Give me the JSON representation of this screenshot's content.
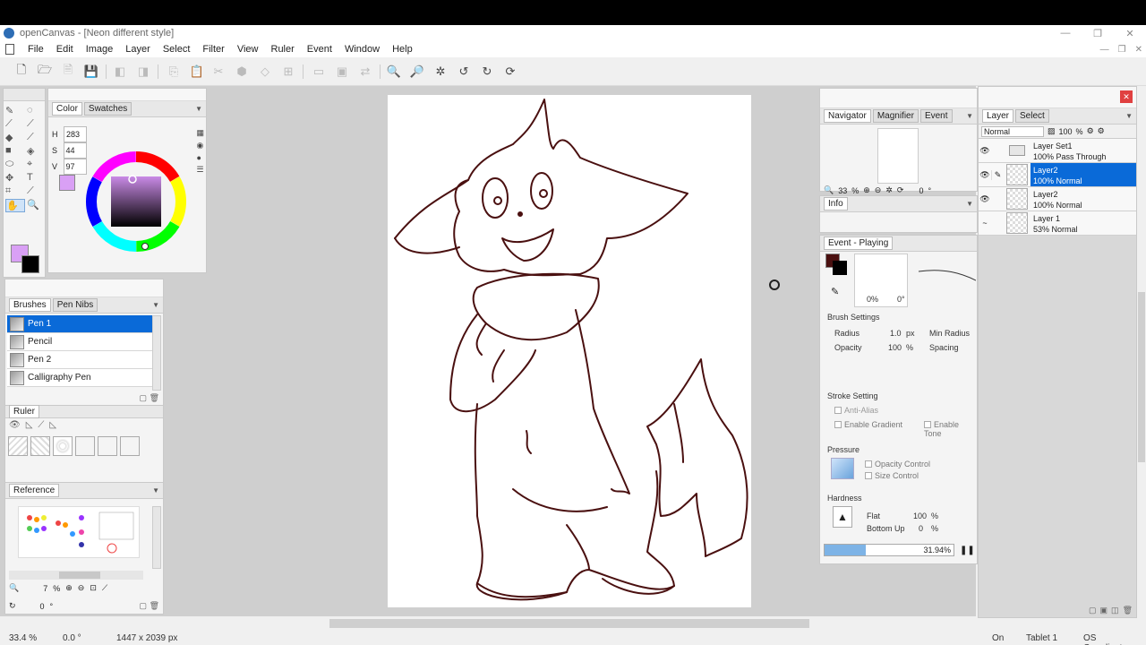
{
  "window": {
    "title": "openCanvas - [Neon different style]"
  },
  "menu": [
    "File",
    "Edit",
    "Image",
    "Layer",
    "Select",
    "Filter",
    "View",
    "Ruler",
    "Event",
    "Window",
    "Help"
  ],
  "color_panel": {
    "tabs": [
      "Color",
      "Swatches"
    ],
    "h_label": "H",
    "h": "283",
    "s_label": "S",
    "s": "44",
    "v_label": "V",
    "v": "97",
    "fg_color": "#d9a0f5",
    "bg_color": "#000000"
  },
  "brushes_panel": {
    "tabs": [
      "Brushes",
      "Pen Nibs"
    ],
    "items": [
      "Pen 1",
      "Pencil",
      "Pen 2",
      "Calligraphy Pen"
    ],
    "selected": "Pen 1"
  },
  "ruler_panel": {
    "title": "Ruler"
  },
  "reference_panel": {
    "title": "Reference",
    "zoom": "7",
    "zoom_unit": "%",
    "rotation": "0",
    "rotation_unit": "°"
  },
  "navigator_panel": {
    "tabs": [
      "Navigator",
      "Magnifier",
      "Event"
    ],
    "zoom": "33",
    "zoom_unit": "%",
    "rotation": "0",
    "rotation_unit": "°"
  },
  "info_panel": {
    "title": "Info"
  },
  "event_panel": {
    "title": "Event - Playing",
    "opacity_readout": "0%",
    "angle_readout": "0°",
    "brush_settings_title": "Brush Settings",
    "radius_label": "Radius",
    "radius": "1.0",
    "radius_unit": "px",
    "min_radius_label": "Min Radius",
    "opacity_label": "Opacity",
    "opacity": "100",
    "opacity_unit": "%",
    "spacing_label": "Spacing",
    "stroke_setting_title": "Stroke Setting",
    "anti_alias": "Anti-Alias",
    "enable_gradient": "Enable Gradient",
    "enable_tone": "Enable Tone",
    "pressure_title": "Pressure",
    "opacity_control": "Opacity Control",
    "size_control": "Size Control",
    "hardness_title": "Hardness",
    "flat_label": "Flat",
    "flat": "100",
    "flat_unit": "%",
    "bottom_up_label": "Bottom Up",
    "bottom_up": "0",
    "bottom_up_unit": "%",
    "progress": "31.94%",
    "progress_value": 0.3194
  },
  "layer_panel": {
    "tabs": [
      "Layer",
      "Select"
    ],
    "blend_mode": "Normal",
    "opacity": "100",
    "opacity_unit": "%",
    "layers": [
      {
        "name": "Layer Set1",
        "detail": "100% Pass Through",
        "selected": false
      },
      {
        "name": "Layer2",
        "detail": "100% Normal",
        "selected": true
      },
      {
        "name": "Layer2",
        "detail": "100% Normal",
        "selected": false
      },
      {
        "name": "Layer 1",
        "detail": "53% Normal",
        "selected": false
      }
    ]
  },
  "status": {
    "zoom": "33.4 %",
    "rotation": "0.0 °",
    "size": "1447 x 2039 px",
    "on": "On",
    "tablet": "Tablet 1",
    "coords": "OS Coordinates"
  },
  "colors": {
    "accent": "#0a6ad8",
    "line_art": "#4a1010"
  }
}
